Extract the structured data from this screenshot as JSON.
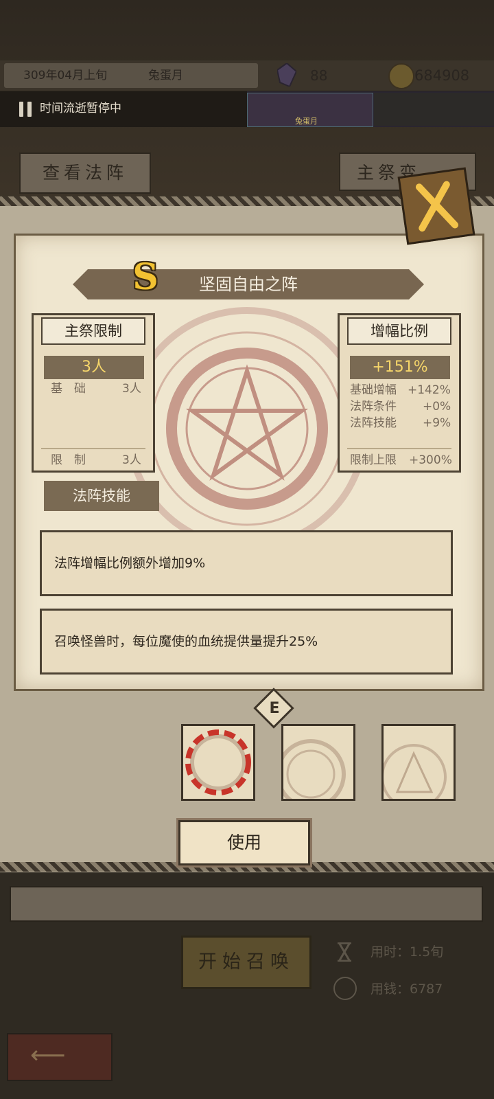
{
  "status_bar": {
    "date": "309年04月上旬",
    "month_name": "兔蛋月",
    "gems": "88",
    "coins": "684908",
    "pause_text": "时间流逝暂停中",
    "event_label": "兔蛋月"
  },
  "background_buttons": {
    "view_formation": "查看法阵",
    "main_sacrifice": "主祭变"
  },
  "formation": {
    "grade": "S",
    "title": "坚固自由之阵",
    "limit_box": {
      "header": "主祭限制",
      "value": "3人",
      "rows": [
        {
          "label": "基　础",
          "value": "3人"
        }
      ],
      "footer": {
        "label": "限　制",
        "value": "3人"
      }
    },
    "amp_box": {
      "header": "增幅比例",
      "value": "+151%",
      "rows": [
        {
          "label": "基础增幅",
          "value": "+142%"
        },
        {
          "label": "法阵条件",
          "value": "+0%"
        },
        {
          "label": "法阵技能",
          "value": "+9%"
        }
      ],
      "footer": {
        "label": "限制上限",
        "value": "+300%"
      }
    },
    "skills_header": "法阵技能",
    "skills": [
      "法阵增幅比例额外增加9%",
      "召唤怪兽时，每位魔使的血统提供量提升25%"
    ],
    "equipped_badge": "E",
    "use_button": "使用"
  },
  "bottom": {
    "start_button": "开始召唤",
    "time_cost": "用时：1.5旬",
    "money_cost": "用钱：6787"
  },
  "colors": {
    "accent_gold": "#f6d66a",
    "band_brown": "#786650",
    "parchment": "#efe6cf"
  }
}
